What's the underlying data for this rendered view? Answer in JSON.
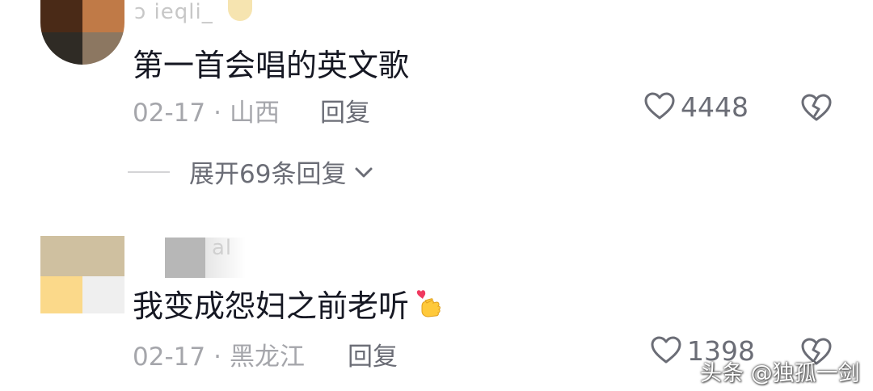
{
  "comments": [
    {
      "username": "ɔ ieqli_",
      "text": "第一首会唱的英文歌",
      "date": "02-17",
      "separator": "·",
      "location": "山西",
      "reply_label": "回复",
      "like_count": "4448",
      "expand_label": "展开69条回复"
    },
    {
      "username": "al",
      "text": "我变成怨妇之前老听",
      "emoji": "finger-heart-emoji",
      "date": "02-17",
      "separator": "·",
      "location": "黑龙江",
      "reply_label": "回复",
      "like_count": "1398"
    }
  ],
  "watermark": "头条 @独孤一剑",
  "colors": {
    "text_primary": "#161823",
    "text_meta": "#a5a6ab",
    "text_action": "#6b6d76"
  }
}
